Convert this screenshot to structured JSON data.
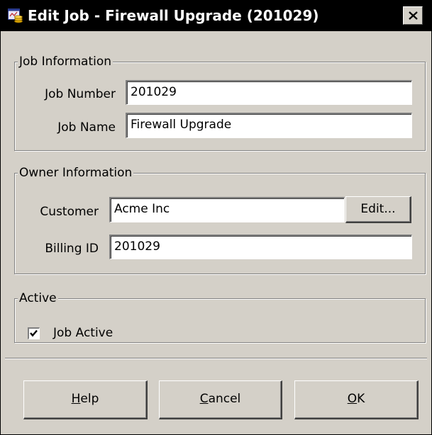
{
  "window": {
    "title": "Edit Job - Firewall Upgrade (201029)"
  },
  "job_info": {
    "legend": "Job Information",
    "job_number_label": "Job Number",
    "job_number_value": "201029",
    "job_name_label": "Job Name",
    "job_name_value": "Firewall Upgrade"
  },
  "owner_info": {
    "legend": "Owner Information",
    "customer_label": "Customer",
    "customer_value": "Acme Inc",
    "edit_button": "Edit...",
    "billing_label": "Billing ID",
    "billing_value": "201029"
  },
  "active": {
    "legend": "Active",
    "checkbox_label": "Job Active",
    "checked": true
  },
  "buttons": {
    "help_mnemonic": "H",
    "help_rest": "elp",
    "cancel_mnemonic": "C",
    "cancel_rest": "ancel",
    "ok_mnemonic": "O",
    "ok_rest": "K"
  },
  "icons": {
    "app": "job-app-icon",
    "close": "close-icon",
    "check": "checkmark-icon"
  },
  "colors": {
    "titlebar": "#000000",
    "dialog_face": "#d4d0c8"
  }
}
